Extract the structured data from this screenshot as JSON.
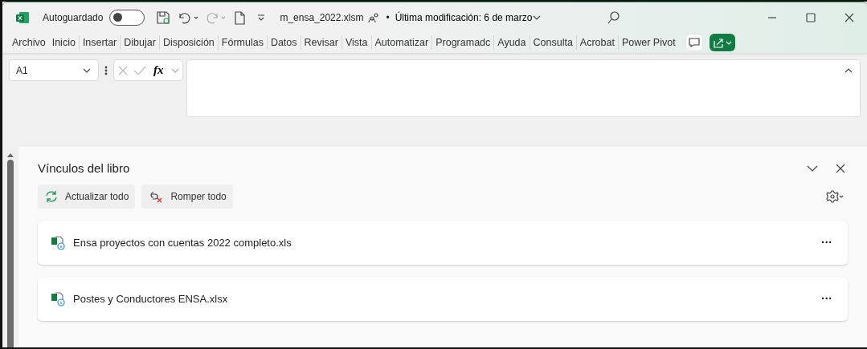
{
  "titlebar": {
    "autosave_label": "Autoguardado",
    "autosave_on": false,
    "filename": "m_ensa_2022.xlsm",
    "separator": "•",
    "modified": "Última modificación: 6 de marzo"
  },
  "ribbon_tabs": [
    {
      "label": "Archivo"
    },
    {
      "label": "Inicio"
    },
    {
      "label": "Insertar"
    },
    {
      "label": "Dibujar"
    },
    {
      "label": "Disposición"
    },
    {
      "label": "Fórmulas"
    },
    {
      "label": "Datos"
    },
    {
      "label": "Revisar"
    },
    {
      "label": "Vista"
    },
    {
      "label": "Automatizar"
    },
    {
      "label": "Programadc"
    },
    {
      "label": "Ayuda"
    },
    {
      "label": "Consulta"
    },
    {
      "label": "Acrobat"
    },
    {
      "label": "Power Pivot"
    }
  ],
  "formula_bar": {
    "name_box": "A1",
    "fx": "fx"
  },
  "pane": {
    "title": "Vínculos del libro",
    "actions": [
      {
        "kind": "refresh",
        "label": "Actualizar todo"
      },
      {
        "kind": "break",
        "label": "Romper todo"
      }
    ],
    "links": [
      {
        "name": "Ensa proyectos con cuentas 2022 completo.xls",
        "more": "···"
      },
      {
        "name": "Postes y Conductores ENSA.xlsx",
        "more": "···"
      }
    ]
  }
}
